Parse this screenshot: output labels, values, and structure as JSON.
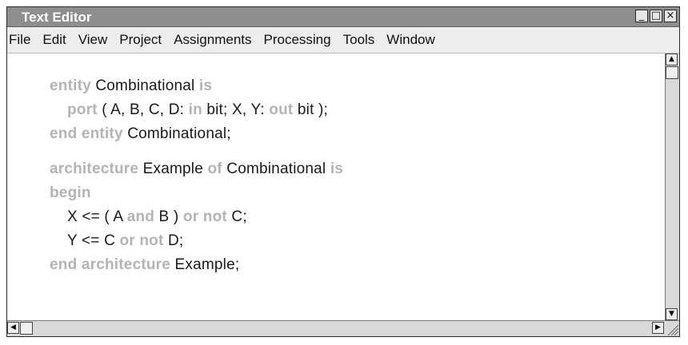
{
  "window": {
    "title": "Text Editor"
  },
  "window_buttons": {
    "minimize": "_",
    "maximize": "□",
    "close": "×"
  },
  "menu": [
    "File",
    "Edit",
    "View",
    "Project",
    "Assignments",
    "Processing",
    "Tools",
    "Window"
  ],
  "code_lines": [
    {
      "indent": 0,
      "gap_before": false,
      "tokens": [
        {
          "t": "entity",
          "k": true
        },
        {
          "t": " Combinational ",
          "k": false
        },
        {
          "t": "is",
          "k": true
        }
      ]
    },
    {
      "indent": 1,
      "gap_before": false,
      "tokens": [
        {
          "t": "port",
          "k": true
        },
        {
          "t": " ( A, B, C, D: ",
          "k": false
        },
        {
          "t": "in",
          "k": true
        },
        {
          "t": " bit; X, Y: ",
          "k": false
        },
        {
          "t": "out",
          "k": true
        },
        {
          "t": " bit );",
          "k": false
        }
      ]
    },
    {
      "indent": 0,
      "gap_before": false,
      "tokens": [
        {
          "t": "end entity",
          "k": true
        },
        {
          "t": " Combinational;",
          "k": false
        }
      ]
    },
    {
      "indent": 0,
      "gap_before": true,
      "tokens": [
        {
          "t": "architecture",
          "k": true
        },
        {
          "t": " Example ",
          "k": false
        },
        {
          "t": "of",
          "k": true
        },
        {
          "t": " Combinational ",
          "k": false
        },
        {
          "t": "is",
          "k": true
        }
      ]
    },
    {
      "indent": 0,
      "gap_before": false,
      "tokens": [
        {
          "t": "begin",
          "k": true
        }
      ]
    },
    {
      "indent": 1,
      "gap_before": false,
      "tokens": [
        {
          "t": "X <= ( A ",
          "k": false
        },
        {
          "t": "and",
          "k": true
        },
        {
          "t": " B ) ",
          "k": false
        },
        {
          "t": "or not",
          "k": true
        },
        {
          "t": " C;",
          "k": false
        }
      ]
    },
    {
      "indent": 1,
      "gap_before": false,
      "tokens": [
        {
          "t": "Y <= C ",
          "k": false
        },
        {
          "t": "or not",
          "k": true
        },
        {
          "t": " D;",
          "k": false
        }
      ]
    },
    {
      "indent": 0,
      "gap_before": false,
      "tokens": [
        {
          "t": "end architecture",
          "k": true
        },
        {
          "t": " Example;",
          "k": false
        }
      ]
    }
  ],
  "colors": {
    "titlebar": "#8e8e8e",
    "keyword": "#b4b4b4",
    "text": "#1a1a1a",
    "menubar": "#ededed"
  },
  "icons": {
    "scroll_up": "scroll-up-arrow-icon",
    "scroll_down": "scroll-down-arrow-icon",
    "scroll_left": "scroll-left-arrow-icon",
    "scroll_right": "scroll-right-arrow-icon",
    "resize": "resize-grip-icon"
  }
}
